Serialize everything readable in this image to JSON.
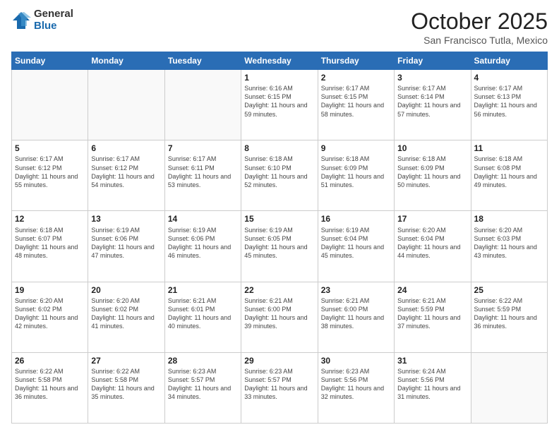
{
  "logo": {
    "general": "General",
    "blue": "Blue"
  },
  "header": {
    "month": "October 2025",
    "location": "San Francisco Tutla, Mexico"
  },
  "weekdays": [
    "Sunday",
    "Monday",
    "Tuesday",
    "Wednesday",
    "Thursday",
    "Friday",
    "Saturday"
  ],
  "rows": [
    [
      {
        "day": "",
        "sunrise": "",
        "sunset": "",
        "daylight": ""
      },
      {
        "day": "",
        "sunrise": "",
        "sunset": "",
        "daylight": ""
      },
      {
        "day": "",
        "sunrise": "",
        "sunset": "",
        "daylight": ""
      },
      {
        "day": "1",
        "sunrise": "6:16 AM",
        "sunset": "6:15 PM",
        "daylight": "11 hours and 59 minutes."
      },
      {
        "day": "2",
        "sunrise": "6:17 AM",
        "sunset": "6:15 PM",
        "daylight": "11 hours and 58 minutes."
      },
      {
        "day": "3",
        "sunrise": "6:17 AM",
        "sunset": "6:14 PM",
        "daylight": "11 hours and 57 minutes."
      },
      {
        "day": "4",
        "sunrise": "6:17 AM",
        "sunset": "6:13 PM",
        "daylight": "11 hours and 56 minutes."
      }
    ],
    [
      {
        "day": "5",
        "sunrise": "6:17 AM",
        "sunset": "6:12 PM",
        "daylight": "11 hours and 55 minutes."
      },
      {
        "day": "6",
        "sunrise": "6:17 AM",
        "sunset": "6:12 PM",
        "daylight": "11 hours and 54 minutes."
      },
      {
        "day": "7",
        "sunrise": "6:17 AM",
        "sunset": "6:11 PM",
        "daylight": "11 hours and 53 minutes."
      },
      {
        "day": "8",
        "sunrise": "6:18 AM",
        "sunset": "6:10 PM",
        "daylight": "11 hours and 52 minutes."
      },
      {
        "day": "9",
        "sunrise": "6:18 AM",
        "sunset": "6:09 PM",
        "daylight": "11 hours and 51 minutes."
      },
      {
        "day": "10",
        "sunrise": "6:18 AM",
        "sunset": "6:09 PM",
        "daylight": "11 hours and 50 minutes."
      },
      {
        "day": "11",
        "sunrise": "6:18 AM",
        "sunset": "6:08 PM",
        "daylight": "11 hours and 49 minutes."
      }
    ],
    [
      {
        "day": "12",
        "sunrise": "6:18 AM",
        "sunset": "6:07 PM",
        "daylight": "11 hours and 48 minutes."
      },
      {
        "day": "13",
        "sunrise": "6:19 AM",
        "sunset": "6:06 PM",
        "daylight": "11 hours and 47 minutes."
      },
      {
        "day": "14",
        "sunrise": "6:19 AM",
        "sunset": "6:06 PM",
        "daylight": "11 hours and 46 minutes."
      },
      {
        "day": "15",
        "sunrise": "6:19 AM",
        "sunset": "6:05 PM",
        "daylight": "11 hours and 45 minutes."
      },
      {
        "day": "16",
        "sunrise": "6:19 AM",
        "sunset": "6:04 PM",
        "daylight": "11 hours and 45 minutes."
      },
      {
        "day": "17",
        "sunrise": "6:20 AM",
        "sunset": "6:04 PM",
        "daylight": "11 hours and 44 minutes."
      },
      {
        "day": "18",
        "sunrise": "6:20 AM",
        "sunset": "6:03 PM",
        "daylight": "11 hours and 43 minutes."
      }
    ],
    [
      {
        "day": "19",
        "sunrise": "6:20 AM",
        "sunset": "6:02 PM",
        "daylight": "11 hours and 42 minutes."
      },
      {
        "day": "20",
        "sunrise": "6:20 AM",
        "sunset": "6:02 PM",
        "daylight": "11 hours and 41 minutes."
      },
      {
        "day": "21",
        "sunrise": "6:21 AM",
        "sunset": "6:01 PM",
        "daylight": "11 hours and 40 minutes."
      },
      {
        "day": "22",
        "sunrise": "6:21 AM",
        "sunset": "6:00 PM",
        "daylight": "11 hours and 39 minutes."
      },
      {
        "day": "23",
        "sunrise": "6:21 AM",
        "sunset": "6:00 PM",
        "daylight": "11 hours and 38 minutes."
      },
      {
        "day": "24",
        "sunrise": "6:21 AM",
        "sunset": "5:59 PM",
        "daylight": "11 hours and 37 minutes."
      },
      {
        "day": "25",
        "sunrise": "6:22 AM",
        "sunset": "5:59 PM",
        "daylight": "11 hours and 36 minutes."
      }
    ],
    [
      {
        "day": "26",
        "sunrise": "6:22 AM",
        "sunset": "5:58 PM",
        "daylight": "11 hours and 36 minutes."
      },
      {
        "day": "27",
        "sunrise": "6:22 AM",
        "sunset": "5:58 PM",
        "daylight": "11 hours and 35 minutes."
      },
      {
        "day": "28",
        "sunrise": "6:23 AM",
        "sunset": "5:57 PM",
        "daylight": "11 hours and 34 minutes."
      },
      {
        "day": "29",
        "sunrise": "6:23 AM",
        "sunset": "5:57 PM",
        "daylight": "11 hours and 33 minutes."
      },
      {
        "day": "30",
        "sunrise": "6:23 AM",
        "sunset": "5:56 PM",
        "daylight": "11 hours and 32 minutes."
      },
      {
        "day": "31",
        "sunrise": "6:24 AM",
        "sunset": "5:56 PM",
        "daylight": "11 hours and 31 minutes."
      },
      {
        "day": "",
        "sunrise": "",
        "sunset": "",
        "daylight": ""
      }
    ]
  ],
  "labels": {
    "sunrise": "Sunrise:",
    "sunset": "Sunset:",
    "daylight": "Daylight:"
  }
}
